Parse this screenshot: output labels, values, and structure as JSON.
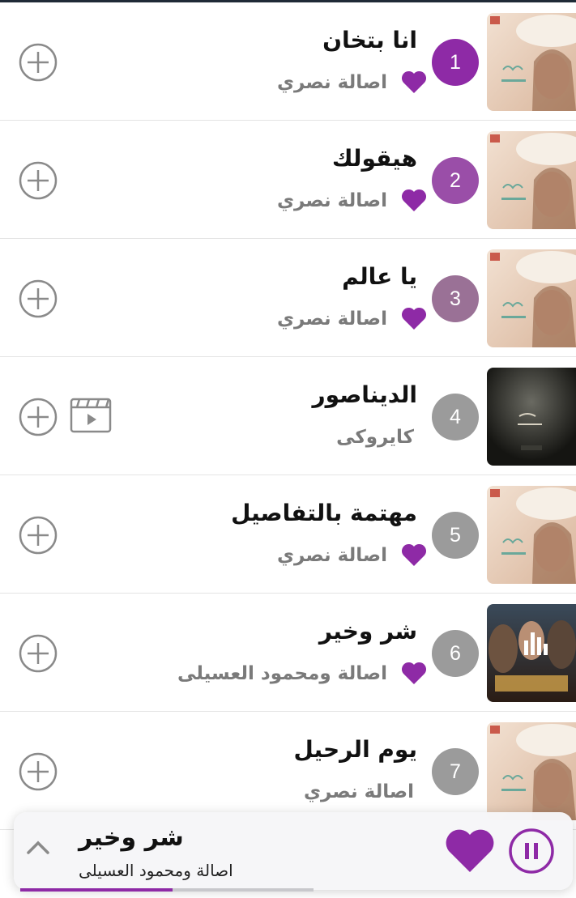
{
  "colors": {
    "accent": "#8e2aa6",
    "rank_1": "#8e2aa6",
    "rank_2": "#9a4ea8",
    "rank_3": "#9a7196",
    "rank_other": "#9b9b9b"
  },
  "songs": [
    {
      "rank": "1",
      "title": "انا بتخان",
      "artist": "اصالة نصري",
      "favorite": true,
      "has_video": false
    },
    {
      "rank": "2",
      "title": "هيقولك",
      "artist": "اصالة نصري",
      "favorite": true,
      "has_video": false
    },
    {
      "rank": "3",
      "title": "يا عالم",
      "artist": "اصالة نصري",
      "favorite": true,
      "has_video": false
    },
    {
      "rank": "4",
      "title": "الديناصور",
      "artist": "كايروكى",
      "favorite": false,
      "has_video": true
    },
    {
      "rank": "5",
      "title": "مهتمة بالتفاصيل",
      "artist": "اصالة نصري",
      "favorite": true,
      "has_video": false
    },
    {
      "rank": "6",
      "title": "شر وخير",
      "artist": "اصالة ومحمود العسيلى",
      "favorite": true,
      "has_video": false,
      "now_playing": true
    },
    {
      "rank": "7",
      "title": "يوم الرحيل",
      "artist": "اصالة نصري",
      "favorite": false,
      "has_video": false
    }
  ],
  "now_playing": {
    "title": "شر وخير",
    "artist": "اصالة ومحمود العسيلى",
    "favorite": true,
    "progress": 0.52
  },
  "icons": {
    "add": "plus-circle-icon",
    "video": "video-clip-icon",
    "favorite": "heart-icon",
    "playing": "equalizer-icon",
    "expand": "chevron-up-icon",
    "pause": "pause-icon"
  }
}
